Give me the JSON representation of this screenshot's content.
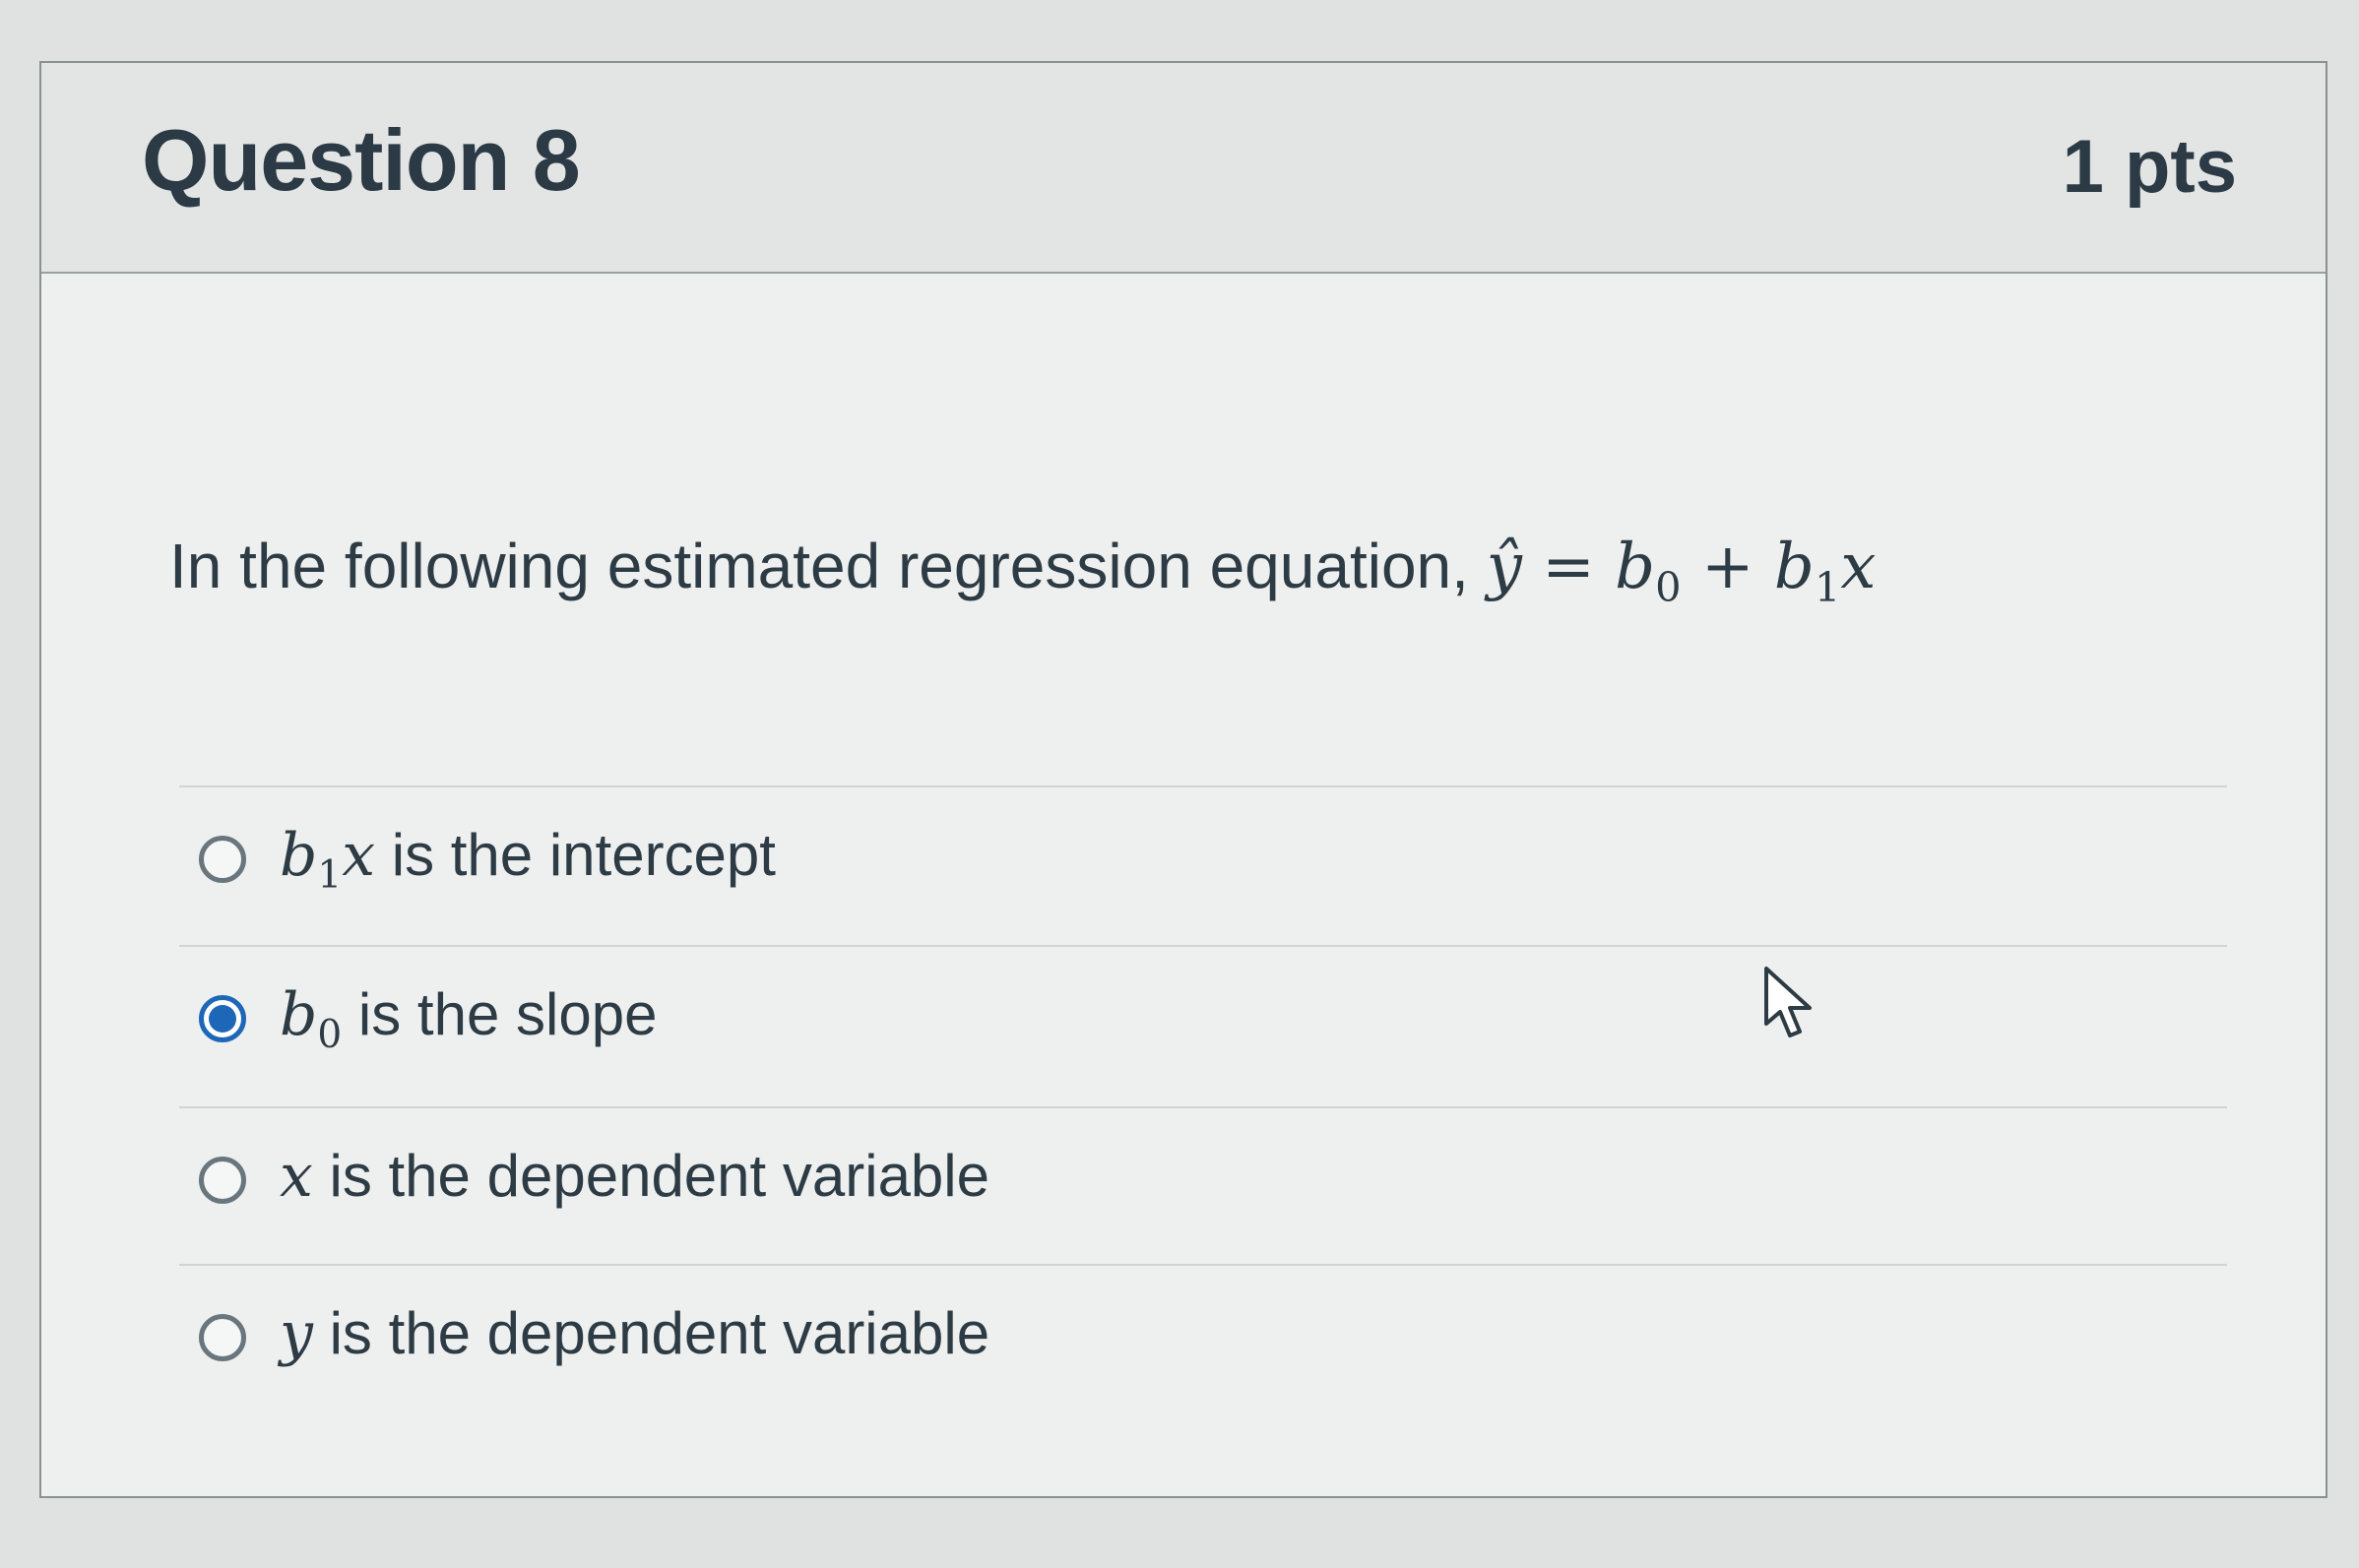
{
  "question": {
    "title": "Question 8",
    "points": "1 pts",
    "prompt_text": "In the following estimated regression equation, ",
    "equation": {
      "lhs": "ŷ",
      "equals": " = ",
      "b": "b",
      "b0_sub": "0",
      "plus": " + ",
      "b1_sub": "1",
      "x": "x"
    }
  },
  "answers": [
    {
      "math_var": "b",
      "math_sub": "1",
      "math_tail": "x",
      "text": " is the intercept",
      "selected": false
    },
    {
      "math_var": "b",
      "math_sub": "0",
      "math_tail": "",
      "text": " is the slope",
      "selected": true
    },
    {
      "math_var": "x",
      "math_sub": "",
      "math_tail": "",
      "text": " is the dependent variable",
      "selected": false
    },
    {
      "math_var": "y",
      "math_sub": "",
      "math_tail": "",
      "text": " is the dependent variable",
      "selected": false
    }
  ],
  "colors": {
    "selected_radio": "#1e67b8",
    "header_bg": "#e2e5e4",
    "text": "#2d3b45"
  },
  "icons": {
    "cursor": "mouse-pointer-icon"
  }
}
